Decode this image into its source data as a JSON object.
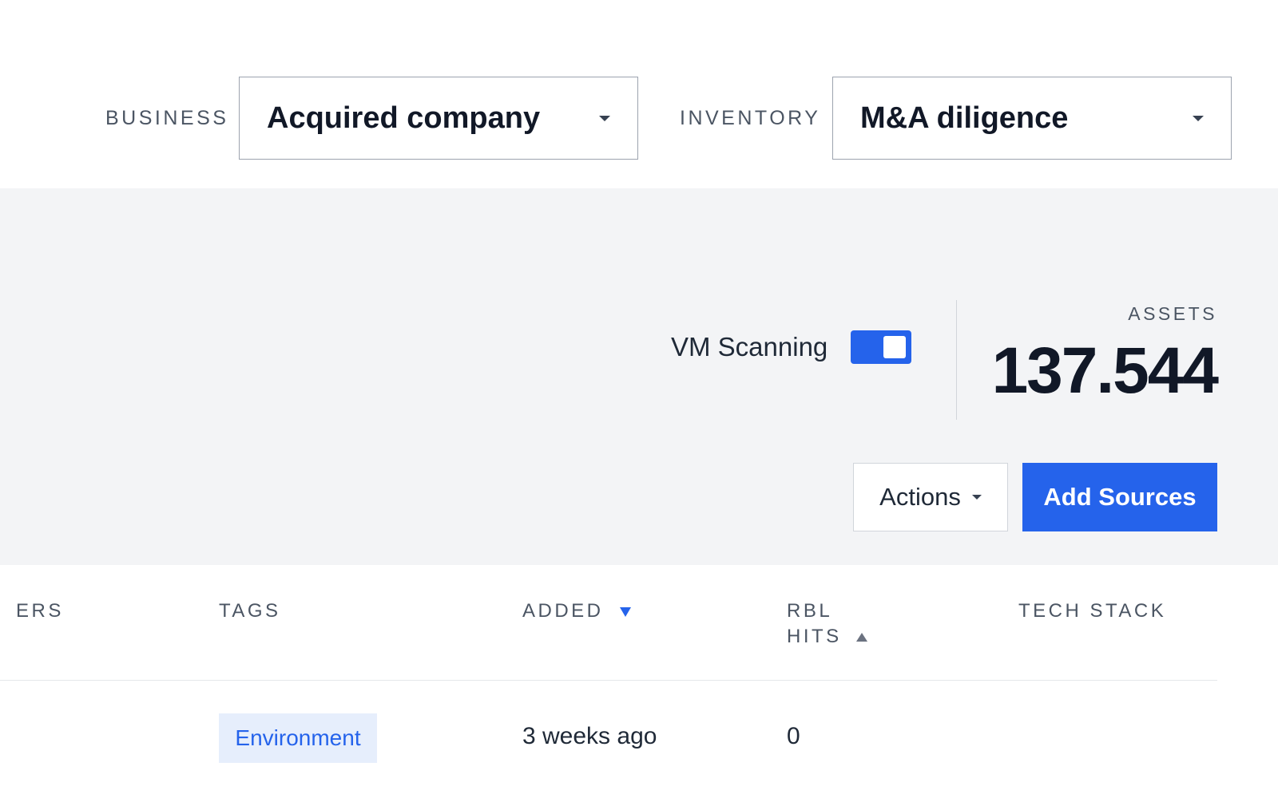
{
  "filters": {
    "business": {
      "label": "BUSINESS",
      "value": "Acquired company"
    },
    "inventory": {
      "label": "INVENTORY",
      "value": "M&A diligence"
    }
  },
  "summary": {
    "vm_scanning": {
      "label": "VM Scanning",
      "enabled": true
    },
    "assets": {
      "label": "ASSETS",
      "value": "137.544"
    },
    "actions_label": "Actions",
    "add_sources_label": "Add Sources"
  },
  "table": {
    "headers": {
      "partial_column": "ERS",
      "tags": "TAGS",
      "added": "ADDED",
      "rbl_hits_line1": "RBL",
      "rbl_hits_line2": "HITS",
      "tech_stack": "TECH STACK"
    },
    "sort": {
      "added": "descending",
      "rbl_hits": "ascending"
    },
    "rows": [
      {
        "tag": "Environment",
        "added": "3 weeks ago",
        "rbl_hits": "0",
        "tech_stack": ""
      }
    ]
  },
  "colors": {
    "accent": "#2563eb",
    "band_background": "#f3f4f6",
    "tag_background": "#e6eefc"
  }
}
